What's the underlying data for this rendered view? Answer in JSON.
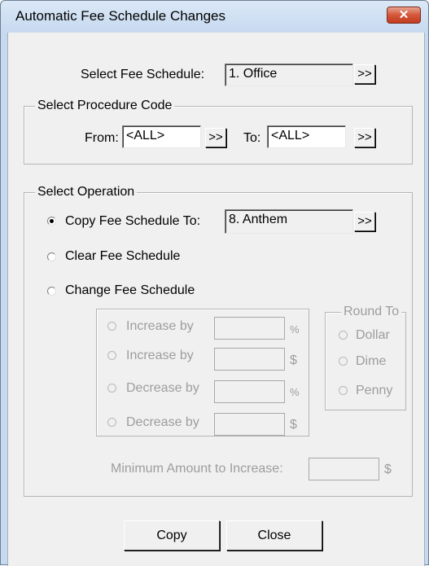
{
  "window": {
    "title": "Automatic Fee Schedule Changes",
    "close_glyph": "✕"
  },
  "fee_schedule": {
    "label": "Select Fee Schedule:",
    "value": "1.  Office",
    "browse_label": ">>"
  },
  "procedure_code": {
    "legend": "Select Procedure Code",
    "from_label": "From:",
    "from_value": "<ALL>",
    "from_browse": ">>",
    "to_label": "To:",
    "to_value": "<ALL>",
    "to_browse": ">>"
  },
  "operation": {
    "legend": "Select Operation",
    "copy_label": "Copy Fee Schedule To:",
    "copy_value": "8.  Anthem",
    "copy_browse": ">>",
    "copy_selected": true,
    "clear_label": "Clear Fee Schedule",
    "change_label": "Change Fee Schedule",
    "adjustments": [
      {
        "label": "Increase by",
        "unit": "%"
      },
      {
        "label": "Increase by",
        "unit": "$"
      },
      {
        "label": "Decrease by",
        "unit": "%"
      },
      {
        "label": "Decrease by",
        "unit": "$"
      }
    ],
    "round_to": {
      "legend": "Round To",
      "options": [
        "Dollar",
        "Dime",
        "Penny"
      ]
    },
    "minimum_label": "Minimum Amount to Increase:",
    "minimum_unit": "$"
  },
  "buttons": {
    "copy": "Copy",
    "close": "Close"
  }
}
